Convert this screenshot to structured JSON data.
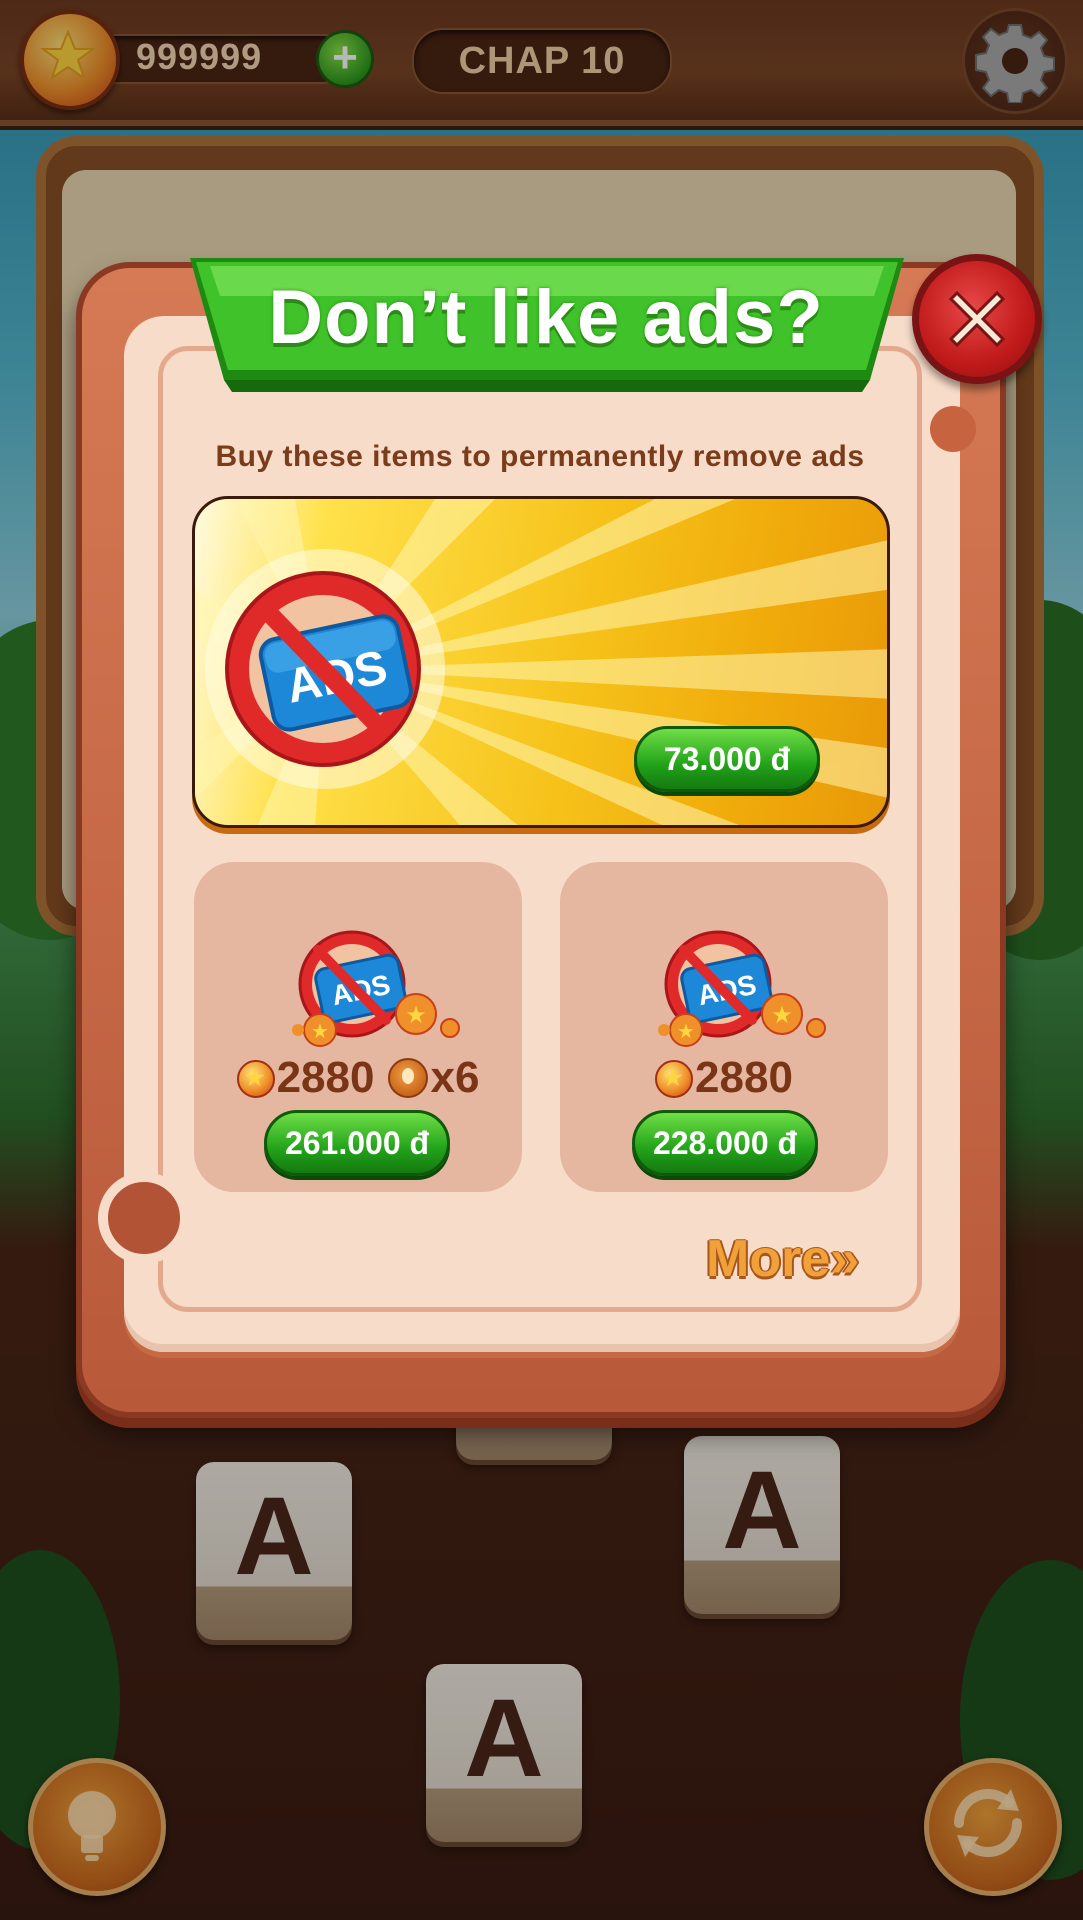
{
  "topbar": {
    "coins": "999999",
    "add_coins_symbol": "+",
    "chapter": "CHAP 10"
  },
  "board": {
    "tiles": [
      "A",
      "A",
      "A"
    ]
  },
  "modal": {
    "title": "Don’t like ads?",
    "subtitle": "Buy these items to permanently remove ads",
    "close_symbol": "✕",
    "big_offer": {
      "icon_label": "ADS",
      "price": "73.000 đ"
    },
    "offers": [
      {
        "icon_label": "ADS",
        "coins": "2880",
        "hints": "x6",
        "price": "261.000 đ"
      },
      {
        "icon_label": "ADS",
        "coins": "2880",
        "price": "228.000 đ"
      }
    ],
    "more_label": "More",
    "more_chevrons": "»"
  },
  "colors": {
    "title_green": "#3fc22a",
    "price_green": "#22a21a",
    "close_red": "#c01a1a",
    "card_bg": "#f7dcca",
    "frame": "#b85a3a",
    "text_brown": "#7a3c1a",
    "more_orange": "#f0a13a"
  },
  "icons": {
    "coin": "star-coin-icon",
    "settings": "gear-icon",
    "close": "close-icon",
    "no_ads": "no-ads-icon",
    "hint": "lightbulb-icon",
    "shuffle": "shuffle-icon"
  }
}
